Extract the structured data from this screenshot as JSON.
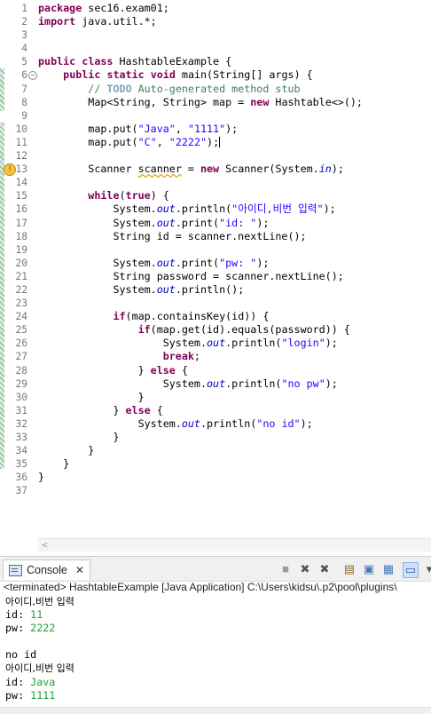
{
  "editor": {
    "lines": [
      {
        "num": "1",
        "tokens": [
          {
            "t": "package",
            "c": "kw"
          },
          {
            "t": " sec16.exam01;"
          }
        ]
      },
      {
        "num": "2",
        "tokens": [
          {
            "t": "import",
            "c": "kw"
          },
          {
            "t": " java.util.*;"
          }
        ]
      },
      {
        "num": "3",
        "tokens": []
      },
      {
        "num": "4",
        "tokens": []
      },
      {
        "num": "5",
        "tokens": [
          {
            "t": "public",
            "c": "kw"
          },
          {
            "t": " "
          },
          {
            "t": "class",
            "c": "kw"
          },
          {
            "t": " HashtableExample {"
          }
        ]
      },
      {
        "num": "6",
        "fold": "−",
        "tokens": [
          {
            "t": "    "
          },
          {
            "t": "public",
            "c": "kw"
          },
          {
            "t": " "
          },
          {
            "t": "static",
            "c": "kw"
          },
          {
            "t": " "
          },
          {
            "t": "void",
            "c": "kw"
          },
          {
            "t": " main(String[] args) {"
          }
        ]
      },
      {
        "num": "7",
        "tokens": [
          {
            "t": "        // ",
            "c": "cm"
          },
          {
            "t": "TODO",
            "c": "todo"
          },
          {
            "t": " Auto-generated method stub",
            "c": "cm"
          }
        ]
      },
      {
        "num": "8",
        "tokens": [
          {
            "t": "        Map<String, String> map = "
          },
          {
            "t": "new",
            "c": "kw"
          },
          {
            "t": " Hashtable<>();"
          }
        ]
      },
      {
        "num": "9",
        "tokens": []
      },
      {
        "num": "10",
        "tokens": [
          {
            "t": "        map.put("
          },
          {
            "t": "\"Java\"",
            "c": "str"
          },
          {
            "t": ", "
          },
          {
            "t": "\"1111\"",
            "c": "str"
          },
          {
            "t": ");"
          }
        ]
      },
      {
        "num": "11",
        "current": true,
        "tokens": [
          {
            "t": "        map.put("
          },
          {
            "t": "\"C\"",
            "c": "str"
          },
          {
            "t": ", "
          },
          {
            "t": "\"2222\"",
            "c": "str"
          },
          {
            "t": ");"
          }
        ]
      },
      {
        "num": "12",
        "tokens": []
      },
      {
        "num": "13",
        "bulb": true,
        "tokens": [
          {
            "t": "        Scanner "
          },
          {
            "t": "scanner",
            "c": "warn"
          },
          {
            "t": " = "
          },
          {
            "t": "new",
            "c": "kw"
          },
          {
            "t": " Scanner(System."
          },
          {
            "t": "in",
            "c": "fld"
          },
          {
            "t": ");"
          }
        ]
      },
      {
        "num": "14",
        "tokens": []
      },
      {
        "num": "15",
        "tokens": [
          {
            "t": "        "
          },
          {
            "t": "while",
            "c": "kw"
          },
          {
            "t": "("
          },
          {
            "t": "true",
            "c": "kw"
          },
          {
            "t": ") {"
          }
        ]
      },
      {
        "num": "16",
        "tokens": [
          {
            "t": "            System."
          },
          {
            "t": "out",
            "c": "fld"
          },
          {
            "t": ".println("
          },
          {
            "t": "\"아이디,비번 입력\"",
            "c": "str"
          },
          {
            "t": ");"
          }
        ]
      },
      {
        "num": "17",
        "tokens": [
          {
            "t": "            System."
          },
          {
            "t": "out",
            "c": "fld"
          },
          {
            "t": ".print("
          },
          {
            "t": "\"id: \"",
            "c": "str"
          },
          {
            "t": ");"
          }
        ]
      },
      {
        "num": "18",
        "tokens": [
          {
            "t": "            String id = scanner.nextLine();"
          }
        ]
      },
      {
        "num": "19",
        "tokens": []
      },
      {
        "num": "20",
        "tokens": [
          {
            "t": "            System."
          },
          {
            "t": "out",
            "c": "fld"
          },
          {
            "t": ".print("
          },
          {
            "t": "\"pw: \"",
            "c": "str"
          },
          {
            "t": ");"
          }
        ]
      },
      {
        "num": "21",
        "tokens": [
          {
            "t": "            String password = scanner.nextLine();"
          }
        ]
      },
      {
        "num": "22",
        "tokens": [
          {
            "t": "            System."
          },
          {
            "t": "out",
            "c": "fld"
          },
          {
            "t": ".println();"
          }
        ]
      },
      {
        "num": "23",
        "tokens": []
      },
      {
        "num": "24",
        "tokens": [
          {
            "t": "            "
          },
          {
            "t": "if",
            "c": "kw"
          },
          {
            "t": "(map.containsKey(id)) {"
          }
        ]
      },
      {
        "num": "25",
        "tokens": [
          {
            "t": "                "
          },
          {
            "t": "if",
            "c": "kw"
          },
          {
            "t": "(map.get(id).equals(password)) {"
          }
        ]
      },
      {
        "num": "26",
        "tokens": [
          {
            "t": "                    System."
          },
          {
            "t": "out",
            "c": "fld"
          },
          {
            "t": ".println("
          },
          {
            "t": "\"login\"",
            "c": "str"
          },
          {
            "t": ");"
          }
        ]
      },
      {
        "num": "27",
        "tokens": [
          {
            "t": "                    "
          },
          {
            "t": "break",
            "c": "kw"
          },
          {
            "t": ";"
          }
        ]
      },
      {
        "num": "28",
        "tokens": [
          {
            "t": "                } "
          },
          {
            "t": "else",
            "c": "kw"
          },
          {
            "t": " {"
          }
        ]
      },
      {
        "num": "29",
        "tokens": [
          {
            "t": "                    System."
          },
          {
            "t": "out",
            "c": "fld"
          },
          {
            "t": ".println("
          },
          {
            "t": "\"no pw\"",
            "c": "str"
          },
          {
            "t": ");"
          }
        ]
      },
      {
        "num": "30",
        "tokens": [
          {
            "t": "                }"
          }
        ]
      },
      {
        "num": "31",
        "tokens": [
          {
            "t": "            } "
          },
          {
            "t": "else",
            "c": "kw"
          },
          {
            "t": " {"
          }
        ]
      },
      {
        "num": "32",
        "tokens": [
          {
            "t": "                System."
          },
          {
            "t": "out",
            "c": "fld"
          },
          {
            "t": ".println("
          },
          {
            "t": "\"no id\"",
            "c": "str"
          },
          {
            "t": ");"
          }
        ]
      },
      {
        "num": "33",
        "tokens": [
          {
            "t": "            }"
          }
        ]
      },
      {
        "num": "34",
        "tokens": [
          {
            "t": "        }"
          }
        ]
      },
      {
        "num": "35",
        "tokens": [
          {
            "t": "    }"
          }
        ]
      },
      {
        "num": "36",
        "tokens": [
          {
            "t": "}"
          }
        ]
      },
      {
        "num": "37",
        "tokens": []
      }
    ]
  },
  "console": {
    "tab_label": "Console",
    "status": "<terminated> HashtableExample [Java Application] C:\\Users\\kidsu\\.p2\\pool\\plugins\\",
    "output": [
      {
        "parts": [
          {
            "t": "아이디,비번 입력",
            "ko": true
          }
        ]
      },
      {
        "parts": [
          {
            "t": "id: "
          },
          {
            "t": "11",
            "in": true
          }
        ]
      },
      {
        "parts": [
          {
            "t": "pw: "
          },
          {
            "t": "2222",
            "in": true
          }
        ]
      },
      {
        "parts": []
      },
      {
        "parts": [
          {
            "t": "no id"
          }
        ]
      },
      {
        "parts": [
          {
            "t": "아이디,비번 입력",
            "ko": true
          }
        ]
      },
      {
        "parts": [
          {
            "t": "id: "
          },
          {
            "t": "Java",
            "in": true
          }
        ]
      },
      {
        "parts": [
          {
            "t": "pw: "
          },
          {
            "t": "1111",
            "in": true
          }
        ]
      }
    ]
  }
}
